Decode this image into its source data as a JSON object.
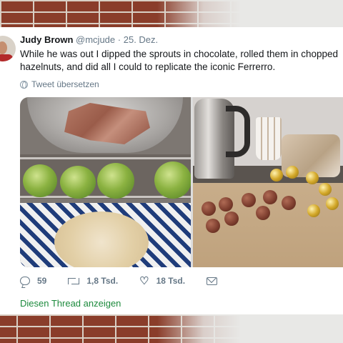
{
  "tweet": {
    "author_name": "Judy Brown",
    "author_handle": "@mcjude",
    "separator": "·",
    "date": "25. Dez.",
    "text": "While he was out I dipped the sprouts in chocolate, rolled them in chopped hazelnuts, and did all I could to replicate the iconic Ferrerro.",
    "translate_label": "Tweet übersetzen"
  },
  "actions": {
    "reply_count": "59",
    "retweet_count": "1,8 Tsd.",
    "like_count": "18 Tsd."
  },
  "thread_link_label": "Diesen Thread anzeigen",
  "colors": {
    "link_green": "#1c8a3c",
    "meta_gray": "#657786",
    "text": "#14171a"
  },
  "icons": [
    "globe-icon",
    "reply-icon",
    "retweet-icon",
    "like-icon",
    "message-icon"
  ]
}
